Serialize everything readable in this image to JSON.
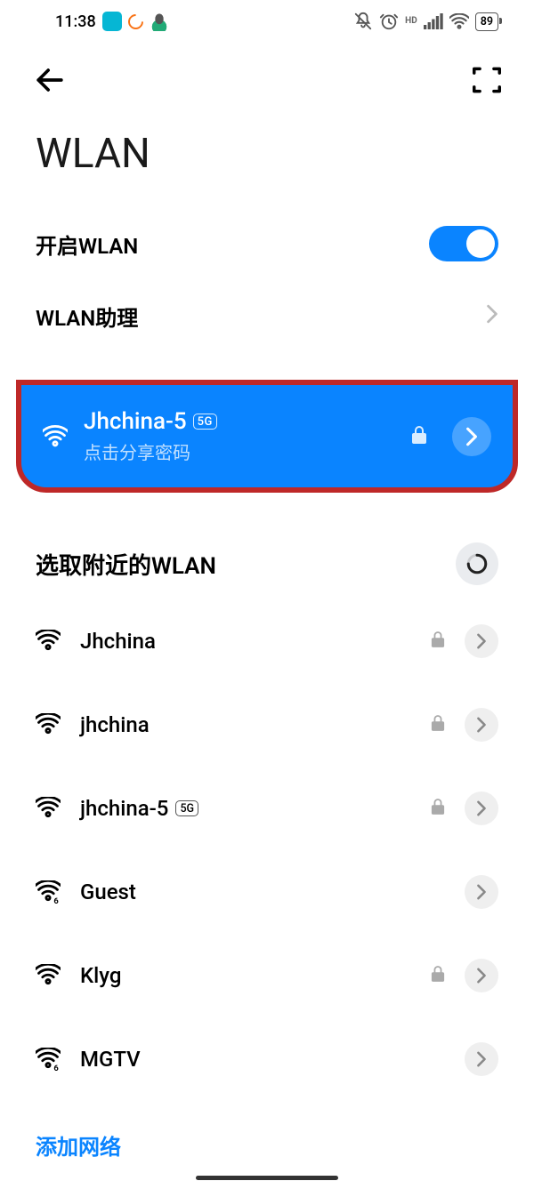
{
  "status_bar": {
    "time": "11:38",
    "battery": "89"
  },
  "page_title": "WLAN",
  "wlan_toggle": {
    "label": "开启WLAN",
    "on": true
  },
  "wlan_assistant": {
    "label": "WLAN助理"
  },
  "connected": {
    "name": "Jhchina-5",
    "band": "5G",
    "subtitle": "点击分享密码",
    "locked": true
  },
  "networks_section": {
    "title": "选取附近的WLAN"
  },
  "networks": [
    {
      "name": "Jhchina",
      "locked": true,
      "band": null,
      "wifi6": false
    },
    {
      "name": "jhchina",
      "locked": true,
      "band": null,
      "wifi6": false
    },
    {
      "name": "jhchina-5",
      "locked": true,
      "band": "5G",
      "wifi6": false
    },
    {
      "name": "Guest",
      "locked": false,
      "band": null,
      "wifi6": true
    },
    {
      "name": "Klyg",
      "locked": true,
      "band": null,
      "wifi6": false
    },
    {
      "name": "MGTV",
      "locked": false,
      "band": null,
      "wifi6": true
    }
  ],
  "add_network": "添加网络"
}
